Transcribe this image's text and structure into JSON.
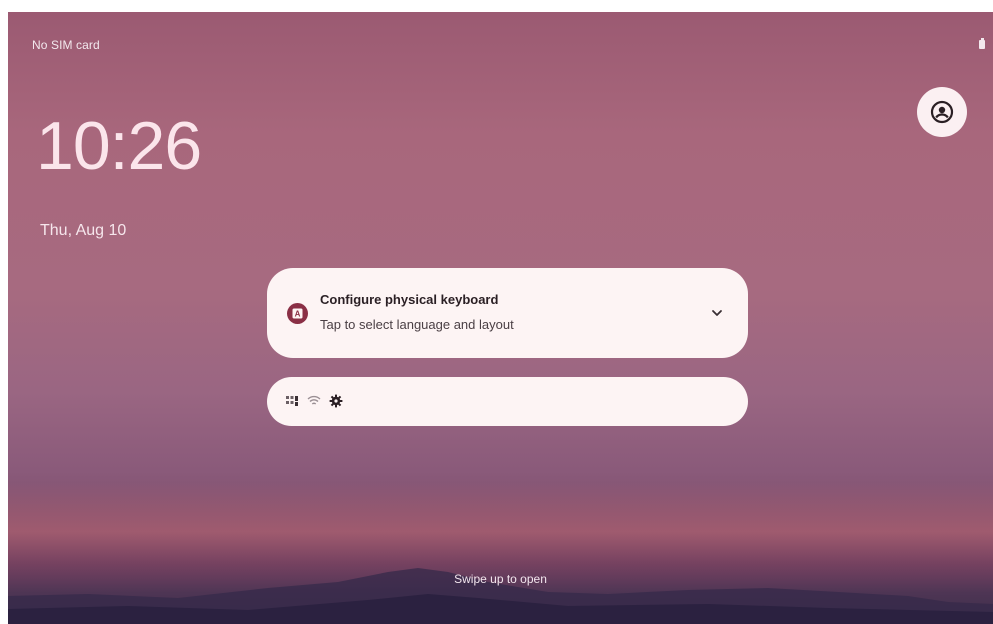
{
  "status_bar": {
    "carrier": "No SIM card",
    "battery_icon": "battery-icon"
  },
  "user_switcher": {
    "icon": "account-circle-icon"
  },
  "clock": {
    "time": "10:26",
    "date": "Thu, Aug 10"
  },
  "notification": {
    "app_icon": "keyboard-app-icon",
    "title": "Configure physical keyboard",
    "text": "Tap to select language and layout",
    "expand_icon": "chevron-down-icon",
    "accent_color": "#8a2f45"
  },
  "notification_shelf": {
    "icons": [
      "apps-grid-icon",
      "wifi-icon",
      "settings-gear-icon"
    ]
  },
  "lock_hint": {
    "text": "Swipe up to open"
  },
  "colors": {
    "card_background": "#fdf4f4",
    "wallpaper_top": "#9b5a72",
    "wallpaper_bottom": "#3a2d4a"
  }
}
